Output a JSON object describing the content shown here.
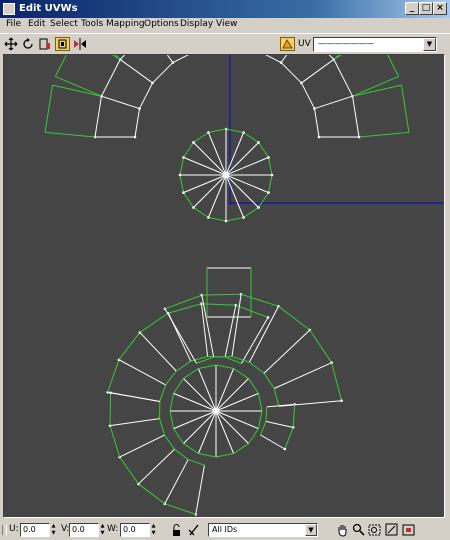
{
  "window": {
    "title": "Edit UVWs"
  },
  "menu": [
    "File",
    "Edit",
    "Select",
    "Tools",
    "Mapping",
    "Options",
    "Display",
    "View"
  ],
  "toolbar": {
    "left_icons": [
      "move-icon",
      "rotate-icon",
      "scale-icon",
      "freeform-icon",
      "mirror-icon"
    ],
    "uv_label": "UV",
    "map_select_value": "———————"
  },
  "status": {
    "u_label": "U:",
    "u_value": "0.0",
    "v_label": "V:",
    "v_value": "0.0",
    "w_label": "W:",
    "w_value": "0.0",
    "id_filter": "All IDs"
  },
  "colors": {
    "viewport_bg": "#454545",
    "uv_edge": "#33cc33",
    "uv_seam": "#ffffff",
    "axis": "#1a1aa0"
  }
}
